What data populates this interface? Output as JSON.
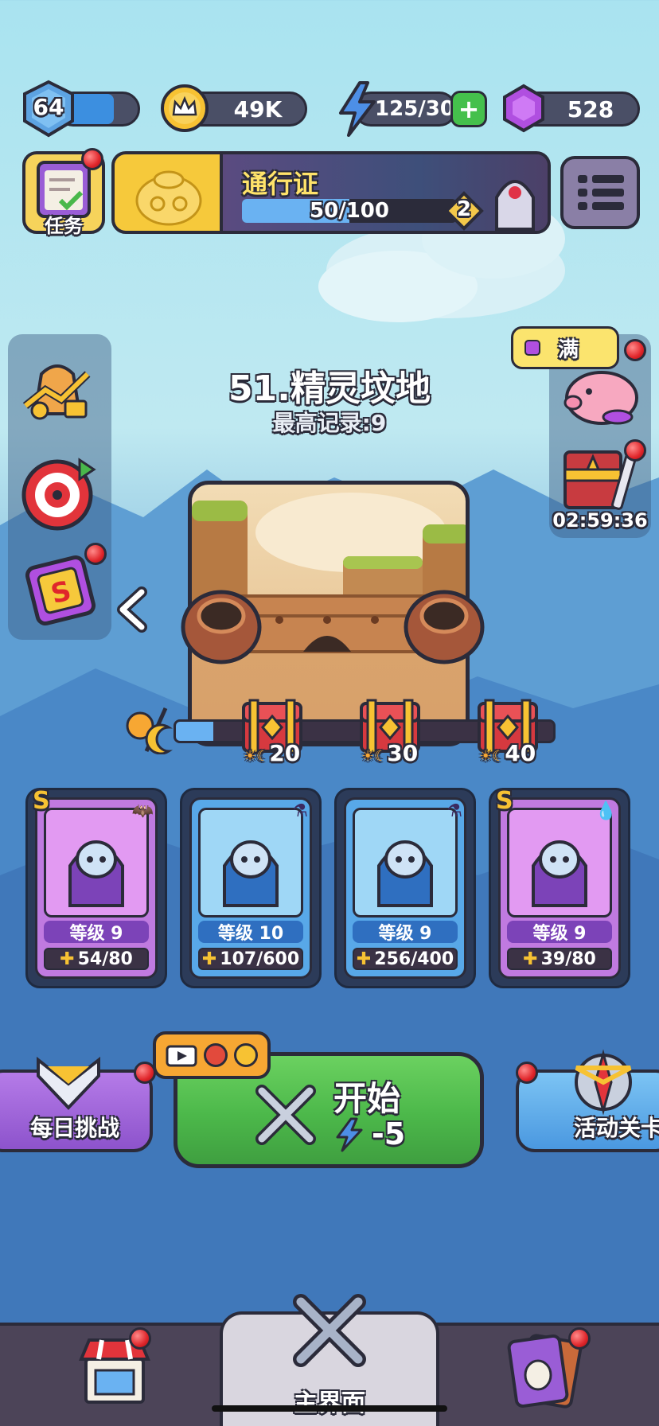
{
  "top_bar": {
    "player_level": "64",
    "coins": "49K",
    "energy": "125/30",
    "gems": "528"
  },
  "tasks_label": "任务",
  "pass": {
    "title": "通行证",
    "progress_text": "50/100",
    "progress": 0.5,
    "tier": "2"
  },
  "level": {
    "name": "51.精灵坟地",
    "record": "最高记录:9"
  },
  "piggy_bank": {
    "status": "满"
  },
  "event_timer": "02:59:36",
  "milestones": [
    {
      "value": "20"
    },
    {
      "value": "30"
    },
    {
      "value": "40"
    }
  ],
  "milestone_progress": 0.1,
  "heroes": [
    {
      "rank": "S",
      "level": "等级 9",
      "fragments": "54/80",
      "theme": "purple",
      "element": "bat"
    },
    {
      "rank": "",
      "level": "等级 10",
      "fragments": "107/600",
      "theme": "blue",
      "element": "potion"
    },
    {
      "rank": "",
      "level": "等级 9",
      "fragments": "256/400",
      "theme": "blue",
      "element": "potion"
    },
    {
      "rank": "S",
      "level": "等级 9",
      "fragments": "39/80",
      "theme": "purple",
      "element": "water"
    }
  ],
  "daily_challenge": "每日挑战",
  "start_button": {
    "label": "开始",
    "cost": "-5"
  },
  "event_stage": "活动关卡",
  "bottom_nav": {
    "main_label": "主界面"
  },
  "colors": {
    "purple_card": "#c07ae0",
    "blue_card": "#58a8e8",
    "start_green": "#4cb84a",
    "gold": "#f7c233"
  }
}
